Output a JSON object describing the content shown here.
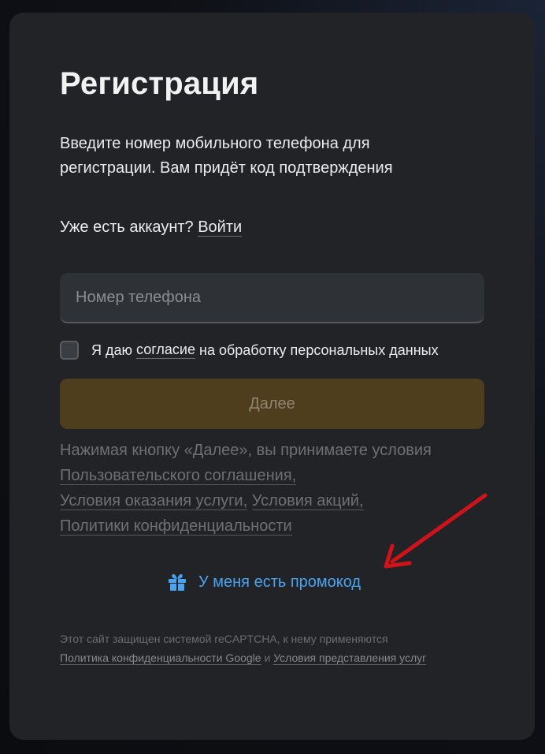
{
  "form": {
    "title": "Регистрация",
    "subtitle": "Введите номер мобильного телефона для регистрации. Вам придёт код подтверждения",
    "account_prompt": "Уже есть аккаунт?",
    "login_link": "Войти",
    "phone_placeholder": "Номер телефона",
    "phone_value": "",
    "consent_prefix": "Я даю",
    "consent_link": "согласие",
    "consent_suffix": "на обработку персональных данных",
    "consent_checked": false,
    "next_button": "Далее"
  },
  "terms": {
    "prefix": "Нажимая кнопку «Далее», вы принимаете условия",
    "link1": "Пользовательского соглашения,",
    "link2": "Условия оказания услуги,",
    "link3": "Условия акций,",
    "link4": "Политики конфиденциальности"
  },
  "promo": {
    "icon": "gift-icon",
    "label": "У меня есть промокод"
  },
  "recaptcha": {
    "text": "Этот сайт защищен системой reCAPTCHA, к нему применяются",
    "link1": "Политика конфиденциальности Google",
    "conj": "и",
    "link2": "Условия представления услуг"
  },
  "colors": {
    "card_bg": "#212327",
    "accent_link": "#4aa3f0",
    "button_disabled_bg": "#4e3e1e",
    "annotation_arrow": "#d0121b"
  }
}
